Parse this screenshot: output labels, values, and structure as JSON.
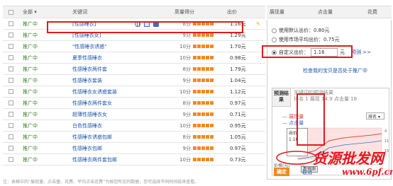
{
  "table": {
    "headers": {
      "all": "全部",
      "keyword": "关键词",
      "score": "质量得分",
      "price": "出价"
    },
    "rows": [
      {
        "status": "推广中",
        "keyword": "[性感睡衣]",
        "score": "8分",
        "bar": 5,
        "price": "1.16元",
        "highlight": true
      },
      {
        "status": "推广中",
        "keyword": "[性感睡衣女]",
        "score": "9分",
        "bar": 5,
        "price": "1.29元"
      },
      {
        "status": "推广中",
        "keyword": "\"性感睡衣诱惑\"",
        "score": "10分",
        "bar": 5,
        "price": "1.70元"
      },
      {
        "status": "推广中",
        "keyword": "夏季性感睡衣",
        "score": "10分",
        "bar": 5,
        "price": "0.98元"
      },
      {
        "status": "推广中",
        "keyword": "性感睡衣两件套",
        "score": "8分",
        "bar": 5,
        "price": "1.79元"
      },
      {
        "status": "推广中",
        "keyword": "性感睡衣套装",
        "score": "9分",
        "bar": 5,
        "price": "1.04元"
      },
      {
        "status": "推广中",
        "keyword": "性感睡衣女诱惑套装",
        "score": "10分",
        "bar": 5,
        "price": "1.12元"
      },
      {
        "status": "推广中",
        "keyword": "性感睡衣两件套女",
        "score": "8分",
        "bar": 5,
        "price": "0.97元"
      },
      {
        "status": "推广中",
        "keyword": "超薄性感睡衣女",
        "score": "9分",
        "bar": 5,
        "price": "0.71元"
      },
      {
        "status": "推广中",
        "keyword": "白色性感睡衣",
        "score": "10分",
        "bar": 5,
        "price": "0.95元"
      },
      {
        "status": "推广中",
        "keyword": "性感睡衣诱惑包邮",
        "score": "8分",
        "bar": 5,
        "price": "1.05元"
      },
      {
        "status": "推广中",
        "keyword": "性感睡衣包邮",
        "score": "9分",
        "bar": 5,
        "price": "0.97元"
      },
      {
        "status": "推广中",
        "keyword": "性感睡衣两件套包邮",
        "score": "10分",
        "bar": 5,
        "price": "0.73元"
      }
    ]
  },
  "right_header": {
    "show": "展现量",
    "click": "点击量",
    "cost": "花费"
  },
  "panel": {
    "opt_default": "使用默认出价：0.80元",
    "opt_market": "使用市场平均出价：0.75元",
    "opt_custom": "自定义出价：",
    "custom_value": "1.16",
    "unit": "元",
    "predict_link": "预测 >>",
    "check_link": "检查我的宝贝是否处于推广中",
    "est_tab": "预测结果",
    "est_stat1": "关键词的预测结果",
    "est_stat2": "排名 1    展现 14.9    点击量 18",
    "legend1": "— 展现量",
    "legend2": "— 点击量",
    "dropdown": "排名",
    "bid_label": "价格(元)",
    "tooltip_label": "出价",
    "tooltip_value": "1.16",
    "predict_btn": "看预测"
  },
  "buttons": {
    "ok": "确定",
    "cancel": "取消"
  },
  "watermark": {
    "line1": "货源批发网",
    "line2": "www.6pf.cn"
  },
  "footnote": "注：表格中的“展现量、点击量、花费、平均点击花费”为按您所见的数据，您可选择不同时间段来查看。",
  "colors": {
    "accent_orange": "#f08a1e",
    "highlight_red": "#e01b1b",
    "link_blue": "#1a54a8",
    "status_green": "#3c7f25"
  }
}
